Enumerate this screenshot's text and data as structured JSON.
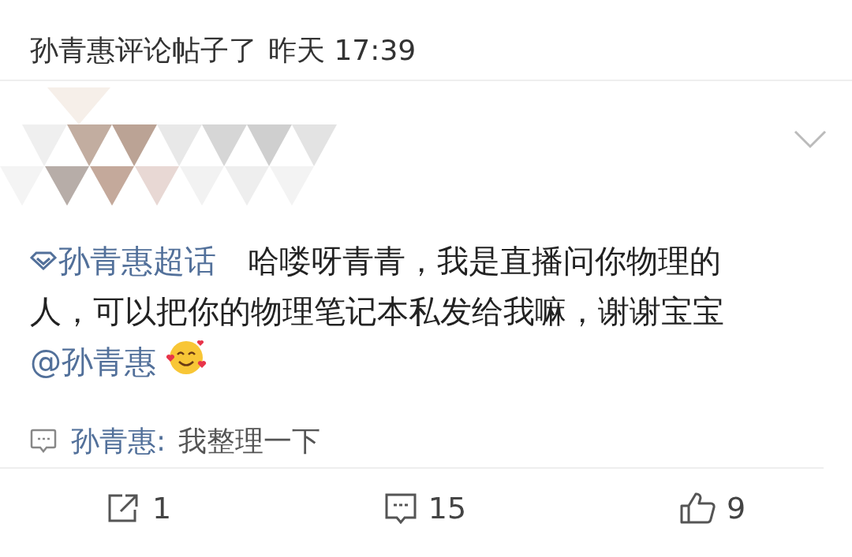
{
  "header": {
    "text": "孙青惠评论帖子了",
    "time": "昨天 17:39"
  },
  "post": {
    "topic": "孙青惠超话",
    "text": "哈喽呀青青，我是直播问你物理的人，可以把你的物理笔记本私发给我嘛，谢谢宝宝",
    "mention": "@孙青惠"
  },
  "reply": {
    "author": "孙青惠:",
    "text": "我整理一下"
  },
  "actions": [
    {
      "kind": "share",
      "count": "1"
    },
    {
      "kind": "comment",
      "count": "15"
    },
    {
      "kind": "like",
      "count": "9"
    }
  ]
}
